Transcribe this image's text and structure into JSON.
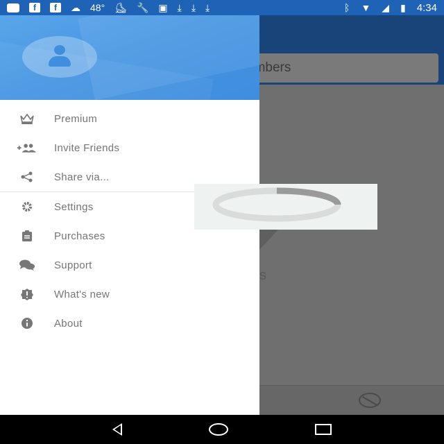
{
  "status_bar": {
    "temperature": "48°",
    "time": "4:34",
    "left_icons": [
      "messages-icon",
      "facebook-icon",
      "facebook-icon",
      "weather-icon",
      "temperature-text",
      "skateboard-icon",
      "wrench-icon",
      "voicemail-icon",
      "download-icon",
      "download-icon",
      "download-icon"
    ],
    "right_icons": [
      "bluetooth-icon",
      "wifi-icon",
      "signal-icon",
      "battery-charging-icon"
    ]
  },
  "app": {
    "search_text": "umbers",
    "partial_text": "s"
  },
  "drawer": {
    "menu_primary": [
      {
        "label": "Premium",
        "icon": "crown-icon"
      },
      {
        "label": "Invite Friends",
        "icon": "add-people-icon"
      },
      {
        "label": "Share via...",
        "icon": "share-icon"
      }
    ],
    "menu_secondary": [
      {
        "label": "Settings",
        "icon": "gear-icon"
      },
      {
        "label": "Purchases",
        "icon": "clipboard-icon"
      },
      {
        "label": "Support",
        "icon": "chat-icon"
      },
      {
        "label": "What's new",
        "icon": "badge-icon"
      },
      {
        "label": "About",
        "icon": "info-icon"
      }
    ]
  },
  "colors": {
    "status_bar": "#1e63b6",
    "drawer_header": "#4796e2",
    "menu_text": "#757575"
  }
}
